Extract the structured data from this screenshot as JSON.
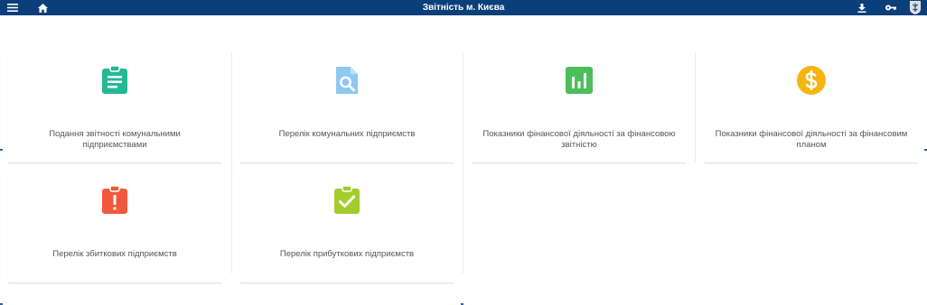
{
  "header": {
    "title": "Звітність м. Києва",
    "icons": [
      "menu-icon",
      "home-icon",
      "download-icon",
      "key-icon",
      "kyiv-crest-icon"
    ]
  },
  "colors": {
    "header_bg": "#0b3f7a",
    "teal": "#26b896",
    "light_blue": "#90c8f0",
    "green": "#4cbf5a",
    "amber": "#f5b50f",
    "red_orange": "#f2583d",
    "lime": "#a3cc2f"
  },
  "cards": [
    {
      "label": "Подання звітності комунальними підприємствами",
      "icon": "clipboard-text-icon"
    },
    {
      "label": "Перелік комунальних підприємств",
      "icon": "document-search-icon"
    },
    {
      "label": "Показники фінансової діяльності за фінансовою звітністю",
      "icon": "bar-chart-icon"
    },
    {
      "label": "Показники фінансової діяльності за фінансовим планом",
      "icon": "dollar-coin-icon"
    },
    {
      "label": "Перелік збиткових підприємств",
      "icon": "clipboard-alert-icon"
    },
    {
      "label": "Перелік прибуткових підприємств",
      "icon": "clipboard-check-icon"
    }
  ]
}
